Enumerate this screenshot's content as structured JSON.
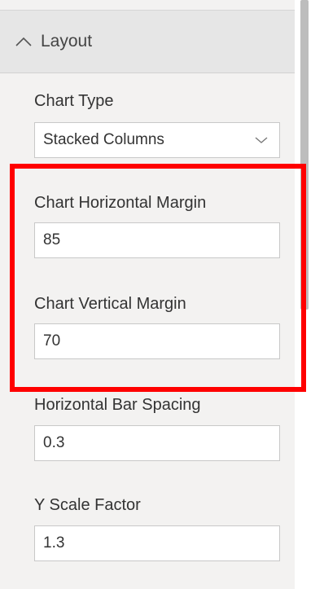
{
  "section": {
    "title": "Layout",
    "collapse_icon": "chevron-up-icon"
  },
  "fields": {
    "chart_type": {
      "label": "Chart Type",
      "value": "Stacked Columns",
      "dropdown_icon": "chevron-down-icon"
    },
    "horizontal_margin": {
      "label": "Chart Horizontal Margin",
      "value": "85"
    },
    "vertical_margin": {
      "label": "Chart Vertical Margin",
      "value": "70"
    },
    "bar_spacing": {
      "label": "Horizontal Bar Spacing",
      "value": "0.3"
    },
    "y_scale": {
      "label": "Y Scale Factor",
      "value": "1.3"
    }
  },
  "colors": {
    "highlight": "#ff0000",
    "panel_bg": "#f3f2f1",
    "header_bg": "#e6e6e6"
  }
}
